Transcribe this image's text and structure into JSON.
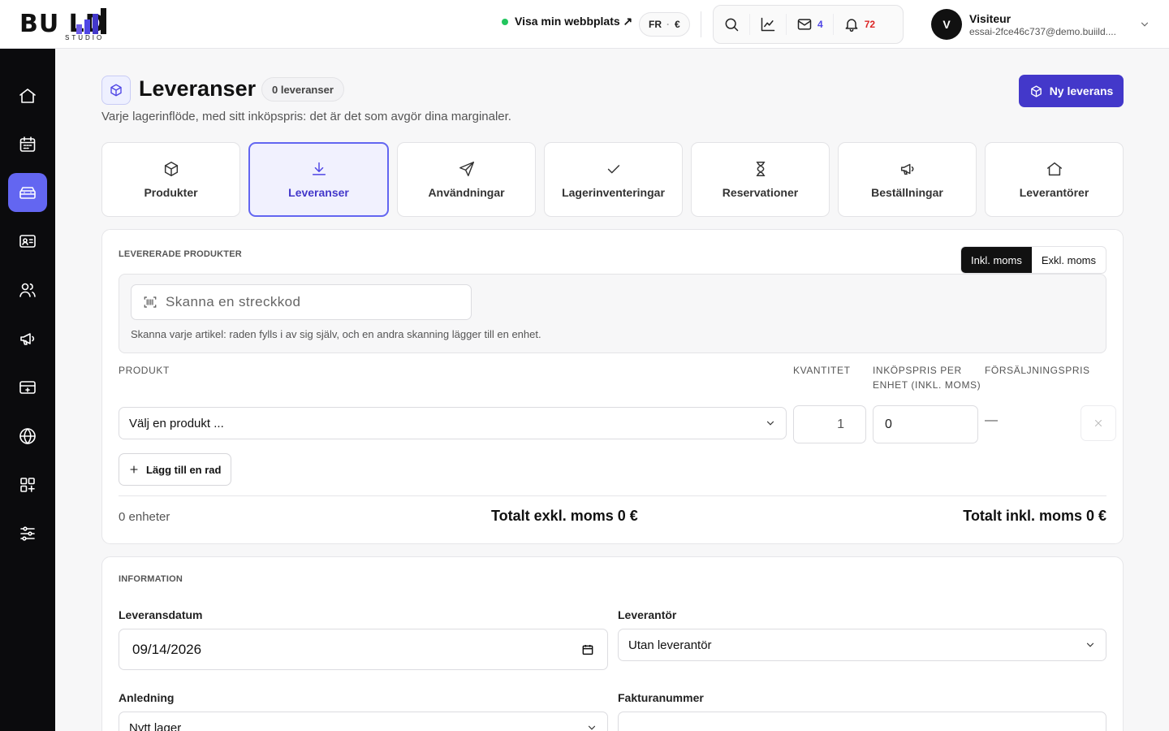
{
  "brand": {
    "logo_text": "BU  LD",
    "logo_sub": "STUDIO"
  },
  "header": {
    "site_link": "Visa min webbplats ↗",
    "lang": "FR",
    "currency": "€",
    "mail_count": "4",
    "notif_count": "72",
    "user_initial": "V",
    "user_name": "Visiteur",
    "user_email": "essai-2fce46c737@demo.buiild...."
  },
  "sidebar": {
    "items": [
      {
        "icon": "home-icon"
      },
      {
        "icon": "calendar-icon"
      },
      {
        "icon": "inventory-icon",
        "active": true
      },
      {
        "icon": "contact-card-icon"
      },
      {
        "icon": "users-icon"
      },
      {
        "icon": "megaphone-icon"
      },
      {
        "icon": "payment-icon"
      },
      {
        "icon": "globe-icon"
      },
      {
        "icon": "apps-icon"
      },
      {
        "icon": "settings-sliders-icon"
      }
    ]
  },
  "page": {
    "title": "Leveranser",
    "count_badge": "0 leveranser",
    "subtitle": "Varje lagerinflöde, med sitt inköpspris: det är det som avgör dina marginaler.",
    "new_button": "Ny leverans"
  },
  "tabs": [
    {
      "label": "Produkter",
      "icon": "box-icon"
    },
    {
      "label": "Leveranser",
      "icon": "download-icon",
      "active": true
    },
    {
      "label": "Användningar",
      "icon": "send-icon"
    },
    {
      "label": "Lagerinventeringar",
      "icon": "check-icon"
    },
    {
      "label": "Reservationer",
      "icon": "hourglass-icon"
    },
    {
      "label": "Beställningar",
      "icon": "megaphone-icon"
    },
    {
      "label": "Leverantörer",
      "icon": "home-icon"
    }
  ],
  "products_section": {
    "label": "LEVERERADE PRODUKTER",
    "vat_incl": "Inkl. moms",
    "vat_excl": "Exkl. moms",
    "scan_placeholder": "Skanna en streckkod",
    "scan_hint": "Skanna varje artikel: raden fylls i av sig själv, och en andra skanning lägger till en enhet.",
    "col_product": "PRODUKT",
    "col_quantity": "KVANTITET",
    "col_purchase_1": "INKÖPSPRIS PER",
    "col_purchase_2": "ENHET (INKL. MOMS)",
    "col_sale": "FÖRSÄLJNINGSPRIS",
    "row": {
      "product_placeholder": "Välj en produkt ...",
      "quantity": "1",
      "purchase_price": "0",
      "sale_price": "—"
    },
    "add_row": "Lägg till en rad",
    "units": "0 enheter",
    "total_excl": "Totalt exkl. moms 0 €",
    "total_incl": "Totalt inkl. moms 0 €"
  },
  "info_section": {
    "label": "INFORMATION",
    "date_label": "Leveransdatum",
    "date_value": "09/14/2026",
    "supplier_label": "Leverantör",
    "supplier_value": "Utan leverantör",
    "reason_label": "Anledning",
    "reason_value": "Nytt lager",
    "invoice_label": "Fakturanummer",
    "invoice_value": ""
  },
  "colors": {
    "accent": "#4f46e5",
    "accent_soft": "#6366f1",
    "sidebar_bg": "#0b0b0d",
    "status_dot": "#22c55e",
    "notif": "#dc2626"
  }
}
